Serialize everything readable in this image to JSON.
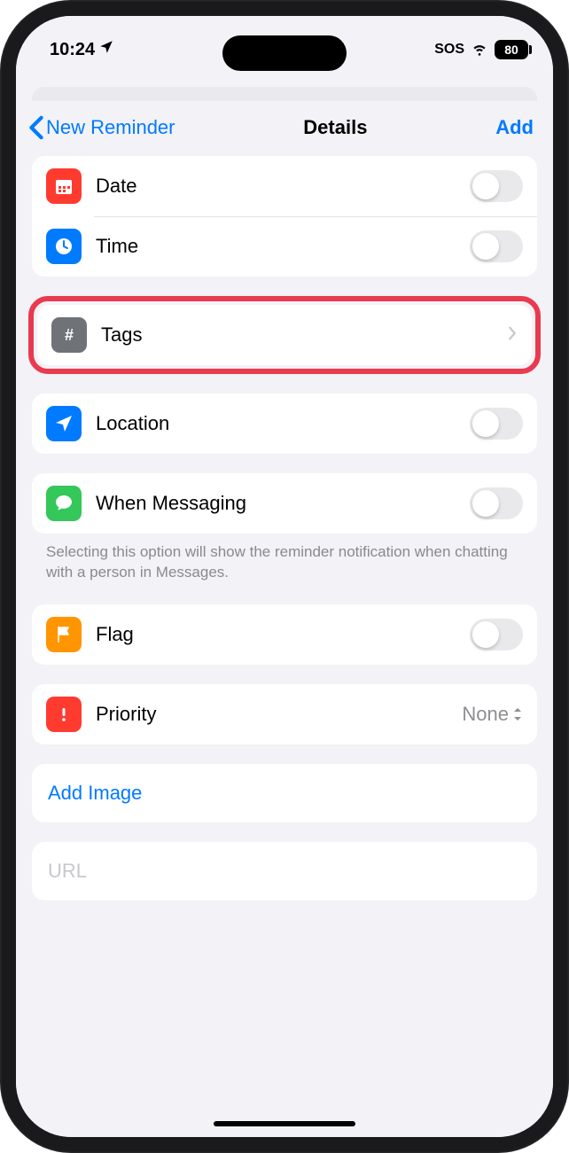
{
  "status": {
    "time": "10:24",
    "sos": "SOS",
    "battery": "80"
  },
  "nav": {
    "back": "New Reminder",
    "title": "Details",
    "action": "Add"
  },
  "rows": {
    "date": "Date",
    "time": "Time",
    "tags": "Tags",
    "location": "Location",
    "messaging": "When Messaging",
    "messaging_footer": "Selecting this option will show the reminder notification when chatting with a person in Messages.",
    "flag": "Flag",
    "priority": "Priority",
    "priority_value": "None",
    "add_image": "Add Image",
    "url_placeholder": "URL"
  },
  "icon_colors": {
    "date": "#ff3b30",
    "time": "#007aff",
    "tags": "#6f7378",
    "location": "#007aff",
    "messaging": "#34c759",
    "flag": "#ff9500",
    "priority": "#ff3b30"
  }
}
